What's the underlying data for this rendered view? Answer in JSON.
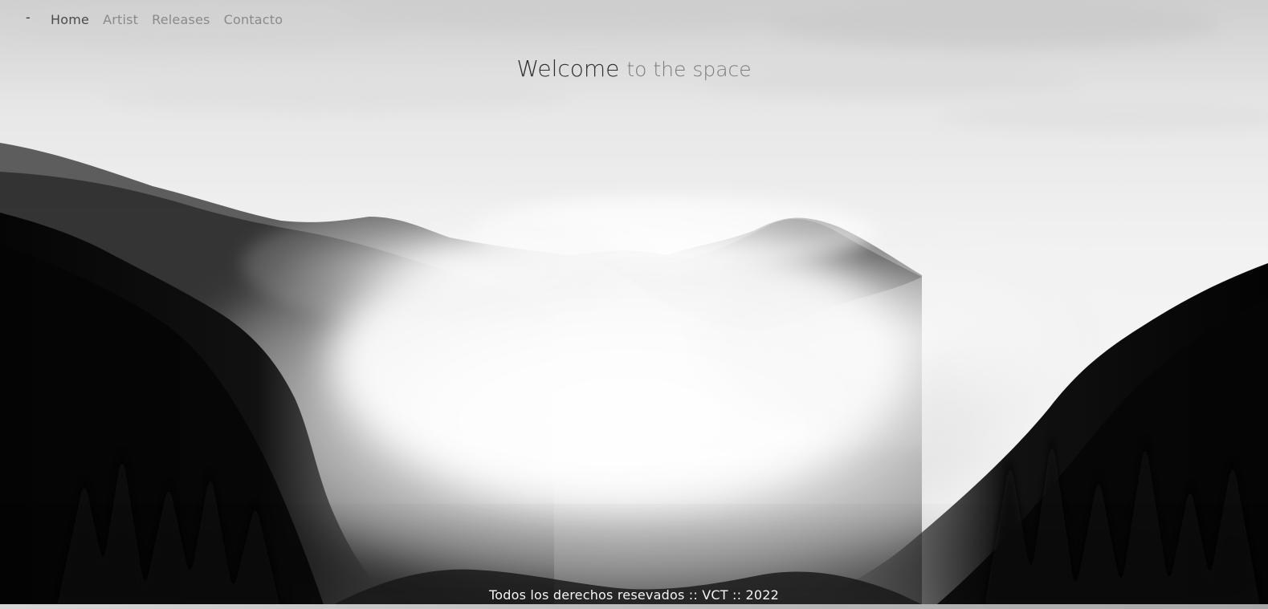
{
  "nav": {
    "brand": "-",
    "items": [
      {
        "label": "Home",
        "active": true
      },
      {
        "label": "Artist",
        "active": false
      },
      {
        "label": "Releases",
        "active": false
      },
      {
        "label": "Contacto",
        "active": false
      }
    ]
  },
  "hero": {
    "title_strong": "Welcome",
    "title_soft": "to the space"
  },
  "footer": {
    "text": "Todos los derechos resevados :: VCT :: 2022"
  },
  "colors": {
    "sky": "#f2f2f2",
    "mountain_dark": "#1b1b1b",
    "forest": "#080808",
    "fog": "#ffffff",
    "text_dark": "#2f2f2f",
    "text_soft": "#7c7c7c"
  }
}
